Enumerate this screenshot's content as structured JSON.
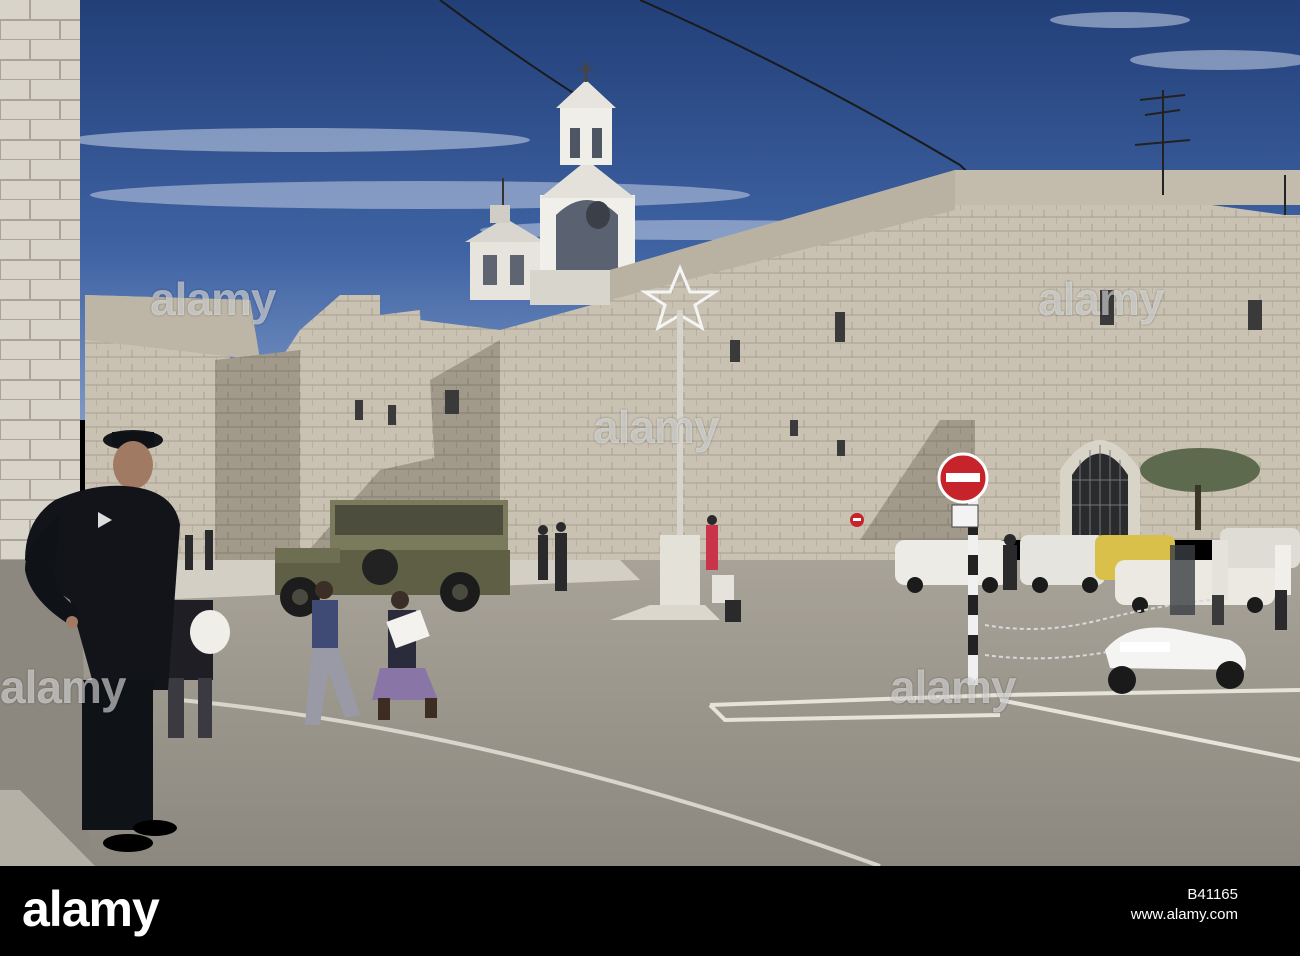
{
  "photo": {
    "description_hidden": false,
    "colors": {
      "sky_top": "#2d4f8c",
      "sky_bottom": "#6f8fc4",
      "stone_light": "#cfc8b8",
      "stone_shadow": "#8e877a",
      "road": "#9a958c",
      "tower_white": "#ecebe5",
      "jeep": "#6b6b4e",
      "uniform": "#111418"
    }
  },
  "watermark": {
    "text": "alamy"
  },
  "footer": {
    "logo": "alamy",
    "image_id": "B41165",
    "url": "www.alamy.com"
  }
}
